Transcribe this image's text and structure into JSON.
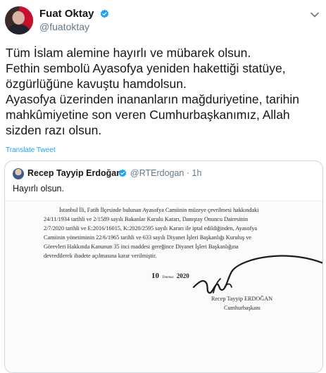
{
  "author": {
    "name": "Fuat Oktay",
    "handle": "@fuatoktay"
  },
  "tweet": {
    "lines": [
      "Tüm İslam alemine hayırlı ve mübarek olsun.",
      "Fethin sembolü Ayasofya yeniden hakettiği statüye,",
      "özgürlüğüne kavuştu hamdolsun.",
      "Ayasofya üzerinden inananların mağduriyetine, tarihin",
      "mahkûmiyetine son veren Cumhurbaşkanımız, Allah",
      "sizden razı olsun."
    ],
    "translate_label": "Translate Tweet"
  },
  "quoted": {
    "name": "Recep Tayyip Erdoğan",
    "handle": "@RTErdogan",
    "time": "· 1h",
    "text": "Hayırlı olsun."
  },
  "document": {
    "lines": [
      "İstanbul İli, Fatih İlçesinde bulunan Ayasofya Camiinin müzeye çevrilmesi hakkındaki",
      "24/11/1934 tarihli ve 2/1589 sayılı Bakanlar Kurulu Kararı, Danıştay Onuncu Dairesinin",
      "2/7/2020 tarihli ve E:2016/16015, K:2020/2595 sayılı Kararı ile iptal edildiğinden, Ayasofya",
      "Camiinin yönetiminin 22/6/1965 tarihli ve 633 sayılı Diyanet İşleri Başkanlığı Kuruluş ve",
      "Görevleri Hakkında Kanunun 35 inci maddesi gereğince Diyanet İşleri Başkanlığına",
      "devredilerek ibadete açılmasına karar verilmiştir."
    ],
    "date_day": "10",
    "date_month": "Temmuz",
    "date_year": "2020",
    "signer_name": "Recep Tayyip ERDOĞAN",
    "signer_title": "Cumhurbaşkanı"
  },
  "colors": {
    "link": "#1da1f2",
    "secondary_text": "#657786",
    "border": "#ccd6dd"
  },
  "icons": {
    "verified": "verified-badge-icon",
    "caret": "chevron-down-icon"
  }
}
